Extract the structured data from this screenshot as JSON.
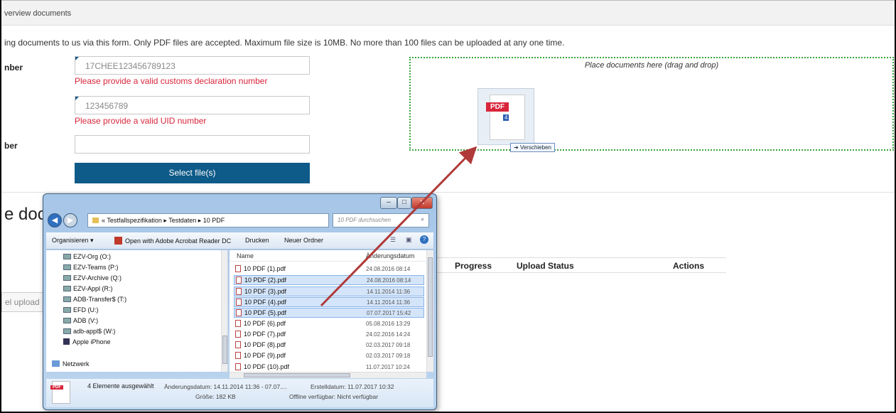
{
  "header": {
    "title": "verview documents"
  },
  "intro": "ing documents to us via this form. Only PDF files are accepted. Maximum file size is 10MB. No more than 100 files can be uploaded at any one time.",
  "form": {
    "label1": "nber",
    "value1": "17CHEE123456789123",
    "error1": "Please provide a valid customs declaration number",
    "value2": "123456789",
    "error2": "Please provide a valid UID number",
    "label3": "ber",
    "value3": "",
    "select_button": "Select file(s)"
  },
  "dropzone": {
    "placeholder": "Place documents here (drag and drop)",
    "drag_badge": "PDF",
    "drag_count": "4",
    "drag_tooltip": "Verschieben"
  },
  "section": {
    "title": "e doc"
  },
  "table": {
    "headers": [
      "Progress",
      "Upload Status",
      "Actions"
    ]
  },
  "cancel_button": "el upload",
  "explorer": {
    "controls": {
      "minimize": "–",
      "maximize": "□",
      "close": "x"
    },
    "breadcrumb": "« Testfallspezifikation ▸ Testdaten ▸ 10 PDF",
    "search_placeholder": "10 PDF durchsuchen",
    "toolbar": [
      "Organisieren ▾",
      "Open with Adobe Acrobat Reader DC",
      "Drucken",
      "Neuer Ordner"
    ],
    "drives": [
      "EZV-Org (O:)",
      "EZV-Teams (P:)",
      "EZV-Archive (Q:)",
      "EZV-Appl (R:)",
      "ADB-Transfer$ (T:)",
      "EFD (U:)",
      "ADB (V:)",
      "adb-appl$ (W:)",
      "Apple iPhone"
    ],
    "network": "Netzwerk",
    "columns": {
      "name": "Name",
      "date": "Änderungsdatum"
    },
    "files": [
      {
        "name": "10 PDF (1).pdf",
        "date": "24.08.2016 08:14",
        "selected": false
      },
      {
        "name": "10 PDF (2).pdf",
        "date": "24.08.2016 08:14",
        "selected": true
      },
      {
        "name": "10 PDF (3).pdf",
        "date": "14.11.2014 11:36",
        "selected": true
      },
      {
        "name": "10 PDF (4).pdf",
        "date": "14.11.2014 11:36",
        "selected": true
      },
      {
        "name": "10 PDF (5).pdf",
        "date": "07.07.2017 15:42",
        "selected": true
      },
      {
        "name": "10 PDF (6).pdf",
        "date": "05.08.2016 13:29",
        "selected": false
      },
      {
        "name": "10 PDF (7).pdf",
        "date": "24.02.2016 14:24",
        "selected": false
      },
      {
        "name": "10 PDF (8).pdf",
        "date": "02.03.2017 09:18",
        "selected": false
      },
      {
        "name": "10 PDF (9).pdf",
        "date": "02.03.2017 09:18",
        "selected": false
      },
      {
        "name": "10 PDF (10).pdf",
        "date": "11.07.2017 10:24",
        "selected": false
      }
    ],
    "details": {
      "icon_label": "PDF",
      "selected": "4 Elemente ausgewählt",
      "changed": "Änderungsdatum: 14.11.2014 11:36 - 07.07....",
      "size": "Größe: 182 KB",
      "created": "Erstelldatum: 11.07.2017 10:32",
      "offline": "Offline verfügbar: Nicht verfügbar"
    }
  },
  "colors": {
    "primary": "#0e5a89",
    "error": "#d9253a",
    "dropzone_border": "#3aa33a",
    "arrow": "#b03a3a"
  }
}
